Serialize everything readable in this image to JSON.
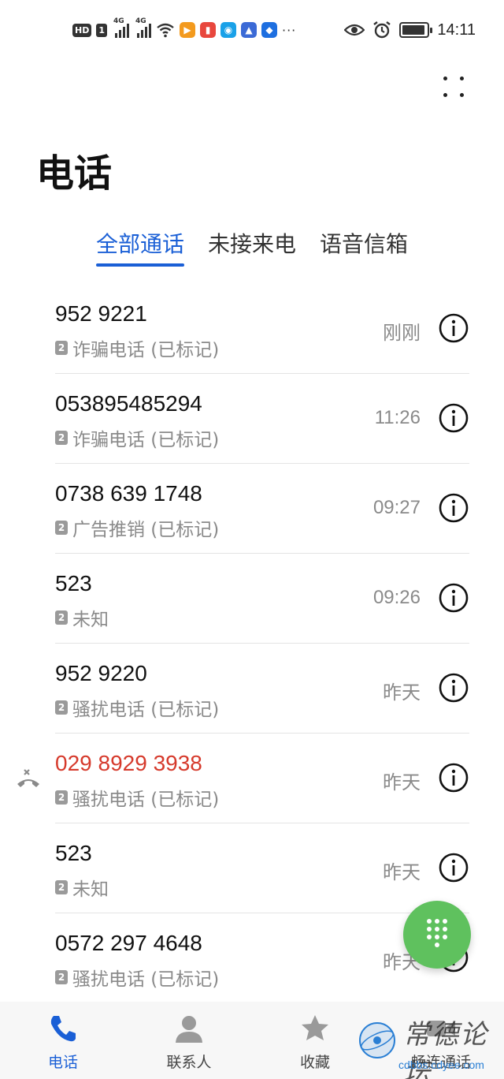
{
  "status_bar": {
    "hd": "HD",
    "sim1": "1",
    "net1": "4G",
    "net2": "4G",
    "more": "···",
    "time": "14:11",
    "icons": [
      "signal-icon",
      "wifi-icon",
      "app-icon",
      "eye-icon",
      "alarm-icon",
      "battery-icon"
    ]
  },
  "page": {
    "title": "电话"
  },
  "tabs": [
    {
      "label": "全部通话",
      "active": true
    },
    {
      "label": "未接来电",
      "active": false
    },
    {
      "label": "语音信箱",
      "active": false
    }
  ],
  "calls": [
    {
      "number": "952 9221",
      "sim": "2",
      "note": "诈骗电话 (已标记)",
      "time": "刚刚",
      "missed": false
    },
    {
      "number": "053895485294",
      "sim": "2",
      "note": "诈骗电话 (已标记)",
      "time": "11:26",
      "missed": false
    },
    {
      "number": "0738 639 1748",
      "sim": "2",
      "note": "广告推销 (已标记)",
      "time": "09:27",
      "missed": false
    },
    {
      "number": "523",
      "sim": "2",
      "note": "未知",
      "time": "09:26",
      "missed": false
    },
    {
      "number": "952 9220",
      "sim": "2",
      "note": "骚扰电话 (已标记)",
      "time": "昨天",
      "missed": false
    },
    {
      "number": "029 8929 3938",
      "sim": "2",
      "note": "骚扰电话 (已标记)",
      "time": "昨天",
      "missed": true
    },
    {
      "number": "523",
      "sim": "2",
      "note": "未知",
      "time": "昨天",
      "missed": false
    },
    {
      "number": "0572 297 4648",
      "sim": "2",
      "note": "骚扰电话 (已标记)",
      "time": "昨天",
      "missed": false
    }
  ],
  "bottom_nav": [
    {
      "label": "电话",
      "icon": "phone-icon",
      "active": true
    },
    {
      "label": "联系人",
      "icon": "contacts-icon",
      "active": false
    },
    {
      "label": "收藏",
      "icon": "star-icon",
      "active": false
    },
    {
      "label": "畅连通话",
      "icon": "video-call-icon",
      "active": false
    }
  ],
  "watermark": {
    "text": "常德论坛",
    "url": "cdbbs.cdyee.com"
  },
  "colors": {
    "accent": "#1a5fd6",
    "missed": "#d63a2c",
    "fab": "#5fc15e",
    "muted": "#8a8a8a"
  }
}
